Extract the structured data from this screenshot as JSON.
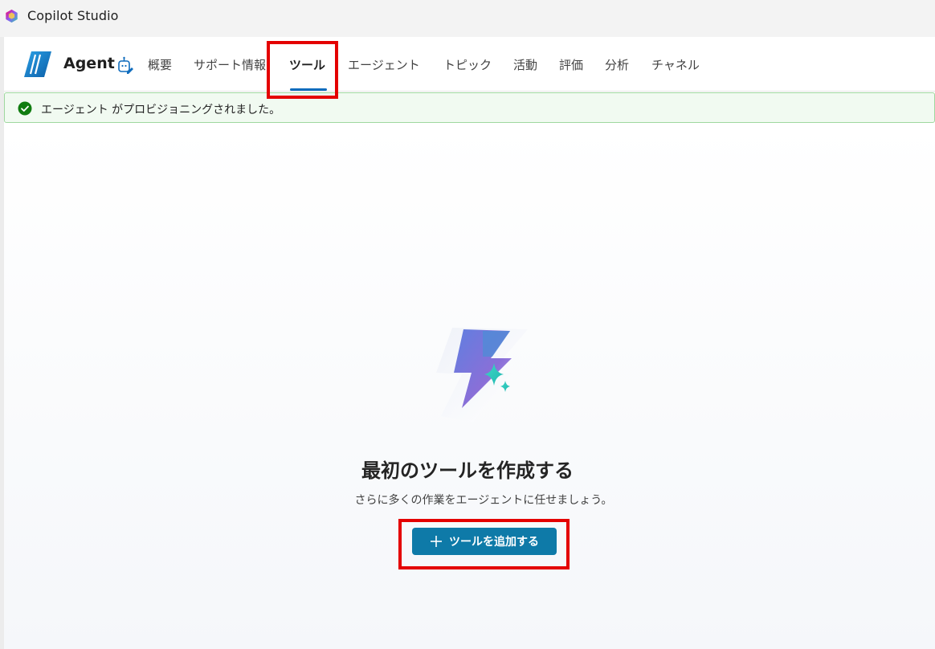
{
  "app": {
    "title": "Copilot Studio"
  },
  "header": {
    "agent_name": "Agent",
    "tabs": [
      {
        "label": "概要"
      },
      {
        "label": "サポート情報"
      },
      {
        "label": "ツール",
        "active": true
      },
      {
        "label": "エージェント"
      },
      {
        "label": "トピック"
      },
      {
        "label": "活動"
      },
      {
        "label": "評価"
      },
      {
        "label": "分析"
      },
      {
        "label": "チャネル"
      }
    ]
  },
  "banner": {
    "message": "エージェント がプロビジョニングされました。",
    "status": "success",
    "icon": "check-circle-icon",
    "color": "#107c10"
  },
  "empty_state": {
    "icon": "lightning-sparkle-icon",
    "title": "最初のツールを作成する",
    "subtitle": "さらに多くの作業をエージェントに任せましょう。",
    "button_label": "ツールを追加する",
    "button_icon": "plus-icon"
  },
  "colors": {
    "accent": "#0e7aa8",
    "tab_underline": "#0f6cbd",
    "highlight": "#e40000",
    "banner_bg": "#f1faf1"
  }
}
